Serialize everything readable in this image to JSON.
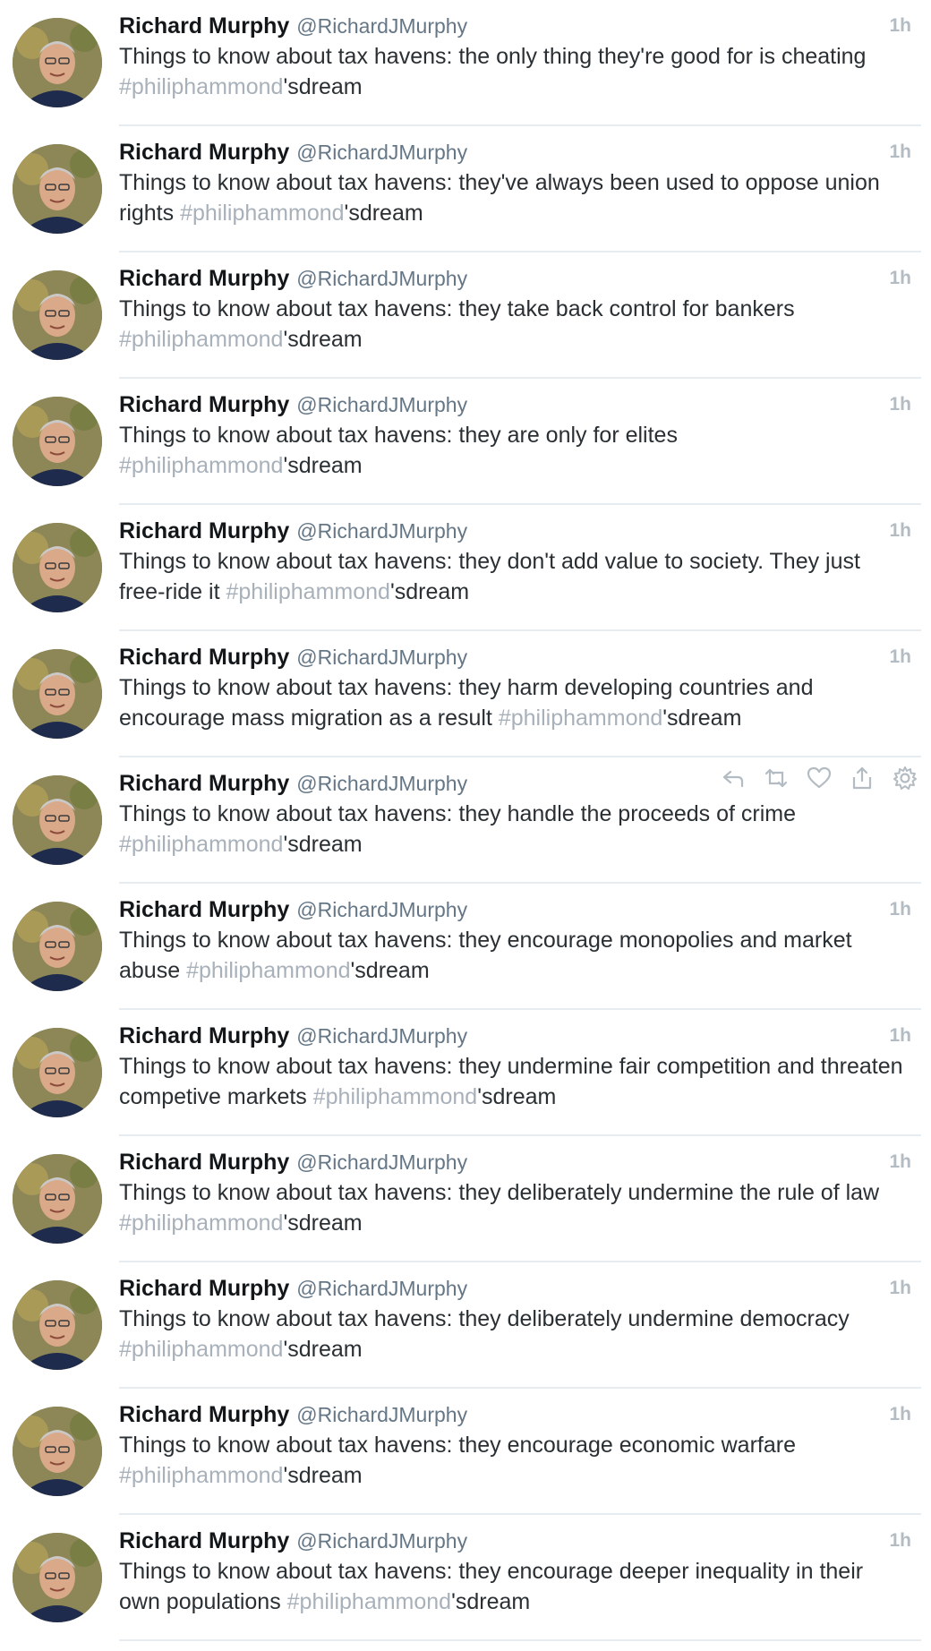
{
  "author": {
    "name": "Richard Murphy",
    "handle": "@RichardJMurphy"
  },
  "colors": {
    "hashtag": "#a8b1ba",
    "timestamp": "#b4bcc3",
    "divider": "#e6ecf0"
  },
  "tweets": [
    {
      "time": "1h",
      "text": "Things to know about tax havens: the only thing they're good for is cheating ",
      "hashtag": "#philiphammond",
      "suffix": "'sdream",
      "hovered": false
    },
    {
      "time": "1h",
      "text": "Things to know about tax havens: they've always been used to oppose union rights ",
      "hashtag": "#philiphammond",
      "suffix": "'sdream",
      "hovered": false
    },
    {
      "time": "1h",
      "text": "Things to know about tax havens: they take back control for bankers ",
      "hashtag": "#philiphammond",
      "suffix": "'sdream",
      "hovered": false
    },
    {
      "time": "1h",
      "text": "Things to know about tax havens: they are only for elites ",
      "hashtag": "#philiphammond",
      "suffix": "'sdream",
      "hovered": false
    },
    {
      "time": "1h",
      "text": "Things to know about tax havens: they don't add value to society. They just free-ride it  ",
      "hashtag": "#philiphammond",
      "suffix": "'sdream",
      "hovered": false
    },
    {
      "time": "1h",
      "text": "Things to know about tax havens: they harm developing countries and encourage mass migration as a result ",
      "hashtag": "#philiphammond",
      "suffix": "'sdream",
      "hovered": false
    },
    {
      "time": "",
      "text": "Things to know about tax havens: they handle the proceeds of crime ",
      "hashtag": "#philiphammond",
      "suffix": "'sdream",
      "hovered": true
    },
    {
      "time": "1h",
      "text": "Things to know about tax havens: they encourage monopolies and market abuse ",
      "hashtag": "#philiphammond",
      "suffix": "'sdream",
      "hovered": false
    },
    {
      "time": "1h",
      "text": "Things to know about tax havens: they undermine fair competition and threaten competive markets ",
      "hashtag": "#philiphammond",
      "suffix": "'sdream",
      "hovered": false
    },
    {
      "time": "1h",
      "text": "Things to know about tax havens: they deliberately undermine the rule of law ",
      "hashtag": "#philiphammond",
      "suffix": "'sdream",
      "hovered": false
    },
    {
      "time": "1h",
      "text": "Things to know about tax havens: they deliberately undermine democracy ",
      "hashtag": "#philiphammond",
      "suffix": "'sdream",
      "hovered": false
    },
    {
      "time": "1h",
      "text": "Things to know about tax havens: they encourage economic warfare ",
      "hashtag": "#philiphammond",
      "suffix": "'sdream",
      "hovered": false
    },
    {
      "time": "1h",
      "text": "Things to know about tax havens: they encourage deeper inequality in their own populations ",
      "hashtag": "#philiphammond",
      "suffix": "'sdream",
      "hovered": false
    }
  ],
  "hover_actions": [
    "reply-icon",
    "retweet-icon",
    "like-icon",
    "share-icon",
    "gear-icon"
  ]
}
